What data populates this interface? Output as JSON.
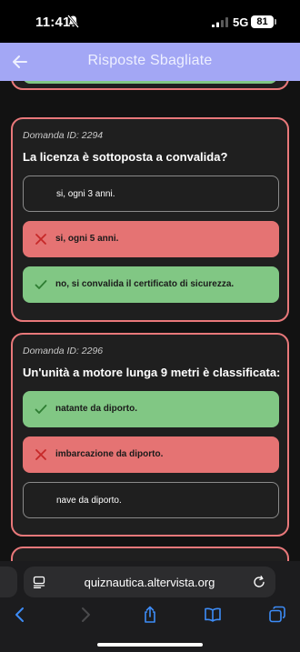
{
  "status_bar": {
    "time": "11:41",
    "network": "5G",
    "battery": "81"
  },
  "app_bar": {
    "title": "Risposte Sbagliate",
    "color": "#a3a7f5"
  },
  "questions": [
    {
      "id_label": "Domanda ID: 2294",
      "text": "La licenza è sottoposta a convalida?",
      "answers": [
        {
          "label": "si, ogni 3 anni.",
          "state": "neutral"
        },
        {
          "label": "si, ogni 5 anni.",
          "state": "wrong"
        },
        {
          "label": "no, si convalida il certificato di sicurezza.",
          "state": "correct"
        }
      ]
    },
    {
      "id_label": "Domanda ID: 2296",
      "text": "Un'unità a motore lunga 9 metri è classificata:",
      "answers": [
        {
          "label": "natante da diporto.",
          "state": "correct"
        },
        {
          "label": "imbarcazione da diporto.",
          "state": "wrong"
        },
        {
          "label": "nave da diporto.",
          "state": "neutral"
        }
      ]
    }
  ],
  "colors": {
    "correct": "#81c784",
    "wrong": "#e57373",
    "card_border": "#e8787a"
  },
  "browser": {
    "url": "quiznautica.altervista.org"
  }
}
